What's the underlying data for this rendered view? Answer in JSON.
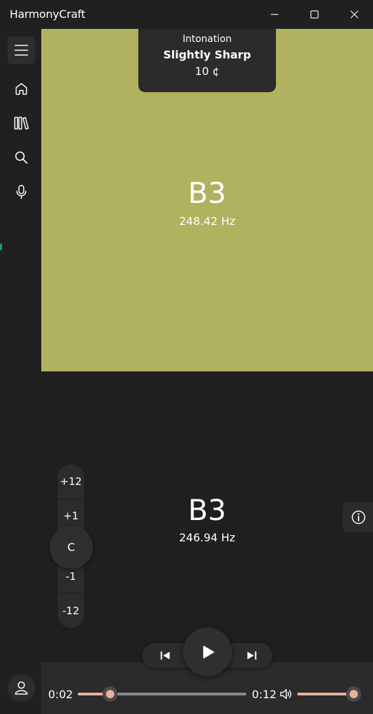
{
  "app": {
    "title": "HarmonyCraft"
  },
  "window_controls": [
    "minimize-icon",
    "maximize-icon",
    "close-icon"
  ],
  "nav": {
    "items": [
      {
        "name": "menu",
        "icon": "hamburger-icon",
        "active": true
      },
      {
        "name": "home",
        "icon": "home-icon"
      },
      {
        "name": "library",
        "icon": "library-icon"
      },
      {
        "name": "search",
        "icon": "search-icon"
      },
      {
        "name": "microphone",
        "icon": "microphone-icon"
      }
    ],
    "account_icon": "account-icon"
  },
  "detected": {
    "intonation_label": "Intonation",
    "intonation_status": "Slightly Sharp",
    "cents": "10 ¢",
    "note": "B3",
    "frequency": "248.42 Hz",
    "panel_color": "#b0b25f"
  },
  "reference": {
    "note": "B3",
    "frequency": "246.94 Hz"
  },
  "transpose": {
    "steps": [
      "+12",
      "+1",
      "C",
      "-1",
      "-12"
    ],
    "current": "C"
  },
  "playback": {
    "elapsed": "0:02",
    "total": "0:12",
    "progress": 0.19,
    "volume": 1.0,
    "accent_color": "#e8b49a"
  },
  "icons": {
    "info": "info-icon",
    "previous": "skip-previous-icon",
    "play": "play-icon",
    "next": "skip-next-icon",
    "volume": "volume-icon"
  }
}
